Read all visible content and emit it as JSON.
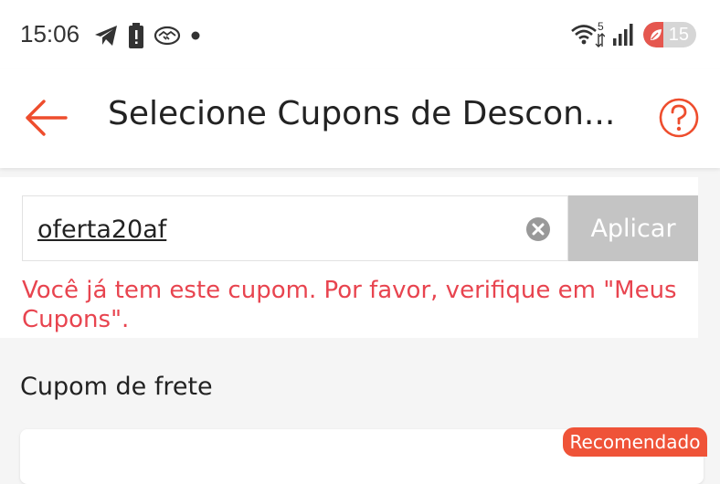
{
  "status_bar": {
    "time": "15:06",
    "left_icons": [
      "telegram-icon",
      "battery-alert-icon",
      "handshake-icon",
      "dot-icon"
    ],
    "right_icons": [
      "wifi-icon",
      "signal-icon"
    ],
    "wifi_label": "5",
    "battery_level": "15",
    "battery_color": "#e5574f"
  },
  "header": {
    "title": "Selecione Cupons de Descon...",
    "accent_color": "#ee4d2d",
    "back_icon": "arrow-left-icon",
    "help_icon": "help-circle-icon"
  },
  "coupon_form": {
    "input_value": "oferta20af",
    "clear_icon": "clear-icon",
    "apply_label": "Aplicar",
    "error_message": "Você já tem este cupom. Por favor, verifique em \"Meus Cupons\".",
    "error_color": "#e8444f"
  },
  "shipping_section": {
    "title": "Cupom de frete",
    "badge": "Recomendado",
    "badge_color": "#ef5338"
  }
}
